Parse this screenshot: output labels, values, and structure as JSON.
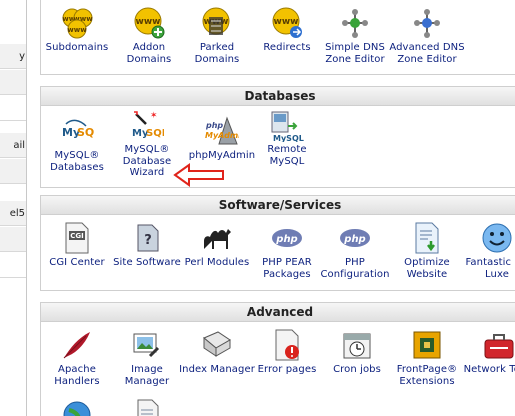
{
  "sidebar": {
    "rows": [
      "y",
      "",
      "",
      "ail",
      "",
      "",
      "el5",
      "",
      ""
    ]
  },
  "domains": {
    "items": [
      {
        "label": "Subdomains",
        "icon": "www-subdomains-icon"
      },
      {
        "label": "Addon Domains",
        "icon": "www-addon-domains-icon"
      },
      {
        "label": "Parked Domains",
        "icon": "www-parked-domains-icon"
      },
      {
        "label": "Redirects",
        "icon": "www-redirects-icon"
      },
      {
        "label": "Simple DNS Zone Editor",
        "icon": "dns-zone-editor-icon"
      },
      {
        "label": "Advanced DNS Zone Editor",
        "icon": "advanced-dns-zone-editor-icon"
      }
    ]
  },
  "databases": {
    "title": "Databases",
    "items": [
      {
        "label": "MySQL® Databases",
        "icon": "mysql-databases-icon"
      },
      {
        "label": "MySQL® Database Wizard",
        "icon": "mysql-wizard-icon"
      },
      {
        "label": "phpMyAdmin",
        "icon": "phpmyadmin-icon"
      },
      {
        "label": "Remote MySQL",
        "icon": "remote-mysql-icon"
      }
    ]
  },
  "software": {
    "title": "Software/Services",
    "items": [
      {
        "label": "CGI Center",
        "icon": "cgi-center-icon"
      },
      {
        "label": "Site Software",
        "icon": "site-software-icon"
      },
      {
        "label": "Perl Modules",
        "icon": "perl-camel-icon"
      },
      {
        "label": "PHP PEAR Packages",
        "icon": "php-pear-icon"
      },
      {
        "label": "PHP Configuration",
        "icon": "php-configuration-icon"
      },
      {
        "label": "Optimize Website",
        "icon": "optimize-website-icon"
      },
      {
        "label": "Fantastic De Luxe",
        "icon": "fantastico-smiley-icon"
      }
    ]
  },
  "advanced": {
    "title": "Advanced",
    "items": [
      {
        "label": "Apache Handlers",
        "icon": "apache-feather-icon"
      },
      {
        "label": "Image Manager",
        "icon": "image-manager-icon"
      },
      {
        "label": "Index Manager",
        "icon": "index-manager-icon"
      },
      {
        "label": "Error pages",
        "icon": "error-pages-icon"
      },
      {
        "label": "Cron jobs",
        "icon": "cron-jobs-icon"
      },
      {
        "label": "FrontPage® Extensions",
        "icon": "frontpage-extensions-icon"
      },
      {
        "label": "Network Tools",
        "icon": "network-tools-icon"
      }
    ]
  },
  "colors": {
    "label": "#0a1e7d",
    "annotation_arrow": "#e0241b"
  }
}
